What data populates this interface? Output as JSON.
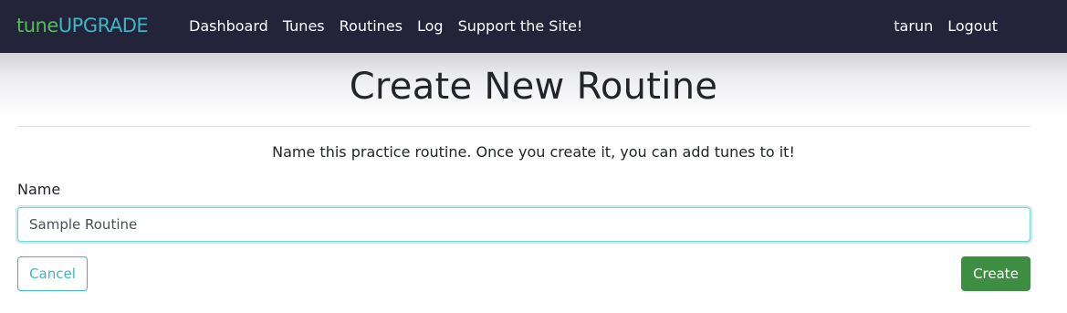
{
  "navbar": {
    "brand_part1": "tune",
    "brand_part2": "UPGRADE",
    "links": [
      "Dashboard",
      "Tunes",
      "Routines",
      "Log",
      "Support the Site!"
    ],
    "user": "tarun",
    "logout": "Logout"
  },
  "page": {
    "title": "Create New Routine",
    "description": "Name this practice routine. Once you create it, you can add tunes to it!"
  },
  "form": {
    "name_label": "Name",
    "name_value": "Sample Routine",
    "cancel_label": "Cancel",
    "create_label": "Create"
  },
  "colors": {
    "navbar_bg": "#23233a",
    "brand_green": "#5cb85c",
    "brand_teal": "#3fb6c3",
    "create_button": "#3e8e41"
  }
}
